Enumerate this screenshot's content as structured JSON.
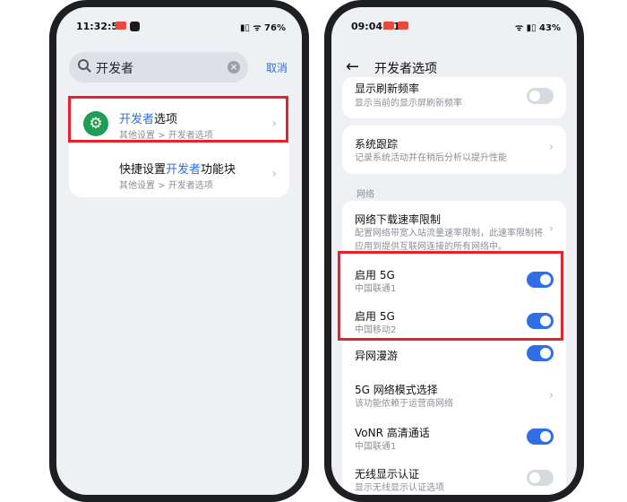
{
  "left_phone": {
    "status": {
      "time": "11:32:55",
      "right": "▮▯ ᯤ 76%"
    },
    "search": {
      "query": "开发者",
      "cancel": "取消"
    },
    "results": [
      {
        "title_hl": "开发者",
        "title_rest": "选项",
        "subtitle": "其他设置 > 开发者选项"
      },
      {
        "title_pre": "快捷设置",
        "title_hl": "开发者",
        "title_rest": "功能块",
        "subtitle": "其他设置 > 开发者选项"
      }
    ],
    "colors": {
      "accent": "#2f6fe3",
      "highlight_box": "#e8212b",
      "icon_bg": "#1f9e55"
    }
  },
  "right_phone": {
    "status": {
      "time": "09:04:01",
      "right": "ᯤ ▮▯ 43%"
    },
    "header": {
      "title": "开发者选项"
    },
    "section_network": "网络",
    "items": {
      "refresh": {
        "title": "显示刷新频率",
        "subtitle": "显示当前的显示屏刷新频率",
        "toggle": "off"
      },
      "trace": {
        "title": "系统跟踪",
        "subtitle": "记录系统活动并在稍后分析以提升性能"
      },
      "download": {
        "title": "网络下载速率限制",
        "subtitle": "配置网络带宽入站流量速率限制，此速率限制将应用到提供互联网连接的所有网络中。"
      },
      "g5a": {
        "title": "启用 5G",
        "subtitle": "中国联通1",
        "toggle": "on"
      },
      "g5b": {
        "title": "启用 5G",
        "subtitle": "中国移动2",
        "toggle": "on"
      },
      "roam": {
        "title": "异网漫游",
        "toggle": "on"
      },
      "mode": {
        "title": "5G 网络模式选择",
        "subtitle": "该功能依赖于运营商网络"
      },
      "vonr": {
        "title": "VoNR 高清通话",
        "subtitle": "中国联通1",
        "toggle": "on"
      },
      "wireless": {
        "title": "无线显示认证",
        "subtitle": "显示无线显示认证选项",
        "toggle": "off"
      }
    }
  }
}
